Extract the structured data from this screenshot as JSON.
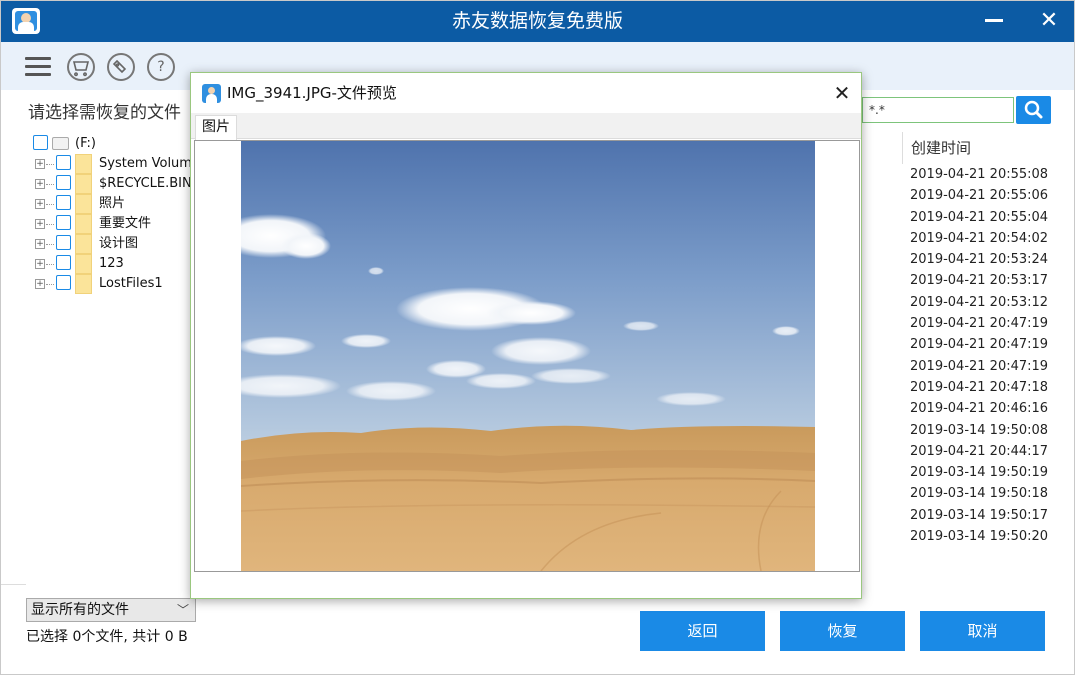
{
  "app": {
    "title": "赤友数据恢复免费版"
  },
  "toolbar": {
    "cart_icon": "cart-icon",
    "tag_icon": "tag-icon",
    "help_glyph": "?"
  },
  "main": {
    "prompt": "请选择需恢复的文件",
    "search_value": "*.*",
    "column_header": "创建时间",
    "times": [
      "2019-04-21 20:55:08",
      "2019-04-21 20:55:06",
      "2019-04-21 20:55:04",
      "2019-04-21 20:54:02",
      "2019-04-21 20:53:24",
      "2019-04-21 20:53:17",
      "2019-04-21 20:53:12",
      "2019-04-21 20:47:19",
      "2019-04-21 20:47:19",
      "2019-04-21 20:47:19",
      "2019-04-21 20:47:18",
      "2019-04-21 20:46:16",
      "2019-03-14 19:50:08",
      "2019-04-21 20:44:17",
      "2019-03-14 19:50:19",
      "2019-03-14 19:50:18",
      "2019-03-14 19:50:17",
      "2019-03-14 19:50:20"
    ]
  },
  "tree": {
    "root": "(F:)",
    "nodes": [
      "System Volume",
      "$RECYCLE.BIN",
      "照片",
      "重要文件",
      "设计图",
      "123",
      "LostFiles1"
    ]
  },
  "bottom": {
    "filter": "显示所有的文件",
    "status": "已选择 0个文件, 共计 0 B",
    "back": "返回",
    "recover": "恢复",
    "cancel": "取消"
  },
  "dialog": {
    "title": "IMG_3941.JPG-文件预览",
    "tab": "图片",
    "close_glyph": "✕"
  }
}
